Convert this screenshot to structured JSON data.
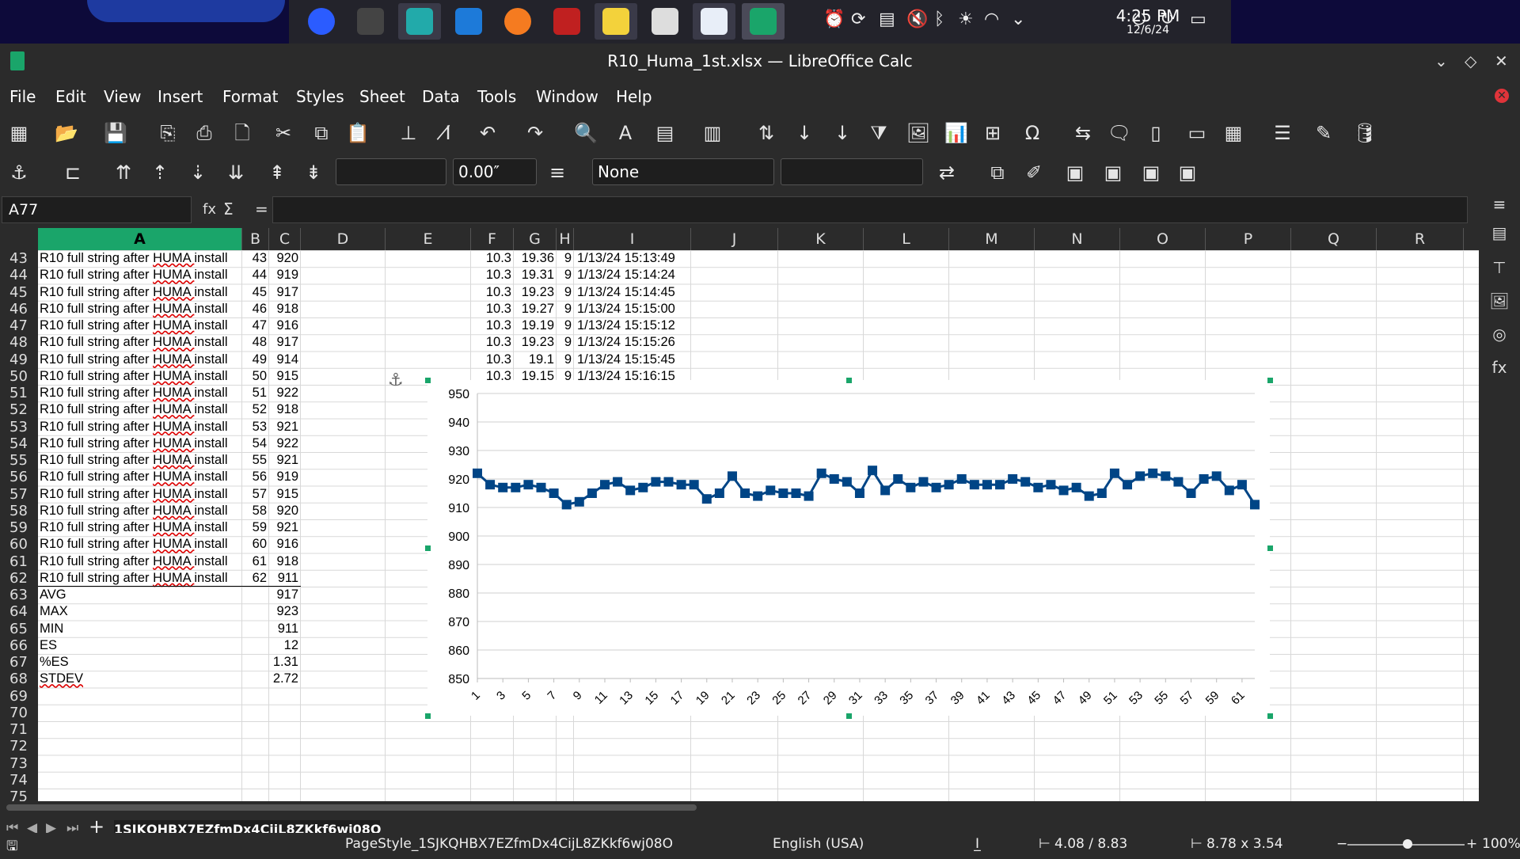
{
  "taskbar": {
    "time": "4:25 PM",
    "date": "12/6/24"
  },
  "window": {
    "title": "R10_Huma_1st.xlsx — LibreOffice Calc"
  },
  "menu": [
    "File",
    "Edit",
    "View",
    "Insert",
    "Format",
    "Styles",
    "Sheet",
    "Data",
    "Tools",
    "Window",
    "Help"
  ],
  "toolbar2": {
    "line_width": "0.00″",
    "arrow_style": "None"
  },
  "formula": {
    "name_box": "A77",
    "fx": "fx",
    "sigma": "Σ",
    "equals": "="
  },
  "columns": [
    "A",
    "B",
    "C",
    "D",
    "E",
    "F",
    "G",
    "H",
    "I",
    "J",
    "K",
    "L",
    "M",
    "N",
    "O",
    "P",
    "Q",
    "R"
  ],
  "rows_start": 43,
  "rows_count": 33,
  "data_rows": [
    {
      "a": "R10 full string after HUMA install",
      "b": "43",
      "c": "920",
      "f": "10.3",
      "g": "19.36",
      "h": "9",
      "i": "1/13/24 15:13:49"
    },
    {
      "a": "R10 full string after HUMA install",
      "b": "44",
      "c": "919",
      "f": "10.3",
      "g": "19.31",
      "h": "9",
      "i": "1/13/24 15:14:24"
    },
    {
      "a": "R10 full string after HUMA install",
      "b": "45",
      "c": "917",
      "f": "10.3",
      "g": "19.23",
      "h": "9",
      "i": "1/13/24 15:14:45"
    },
    {
      "a": "R10 full string after HUMA install",
      "b": "46",
      "c": "918",
      "f": "10.3",
      "g": "19.27",
      "h": "9",
      "i": "1/13/24 15:15:00"
    },
    {
      "a": "R10 full string after HUMA install",
      "b": "47",
      "c": "916",
      "f": "10.3",
      "g": "19.19",
      "h": "9",
      "i": "1/13/24 15:15:12"
    },
    {
      "a": "R10 full string after HUMA install",
      "b": "48",
      "c": "917",
      "f": "10.3",
      "g": "19.23",
      "h": "9",
      "i": "1/13/24 15:15:26"
    },
    {
      "a": "R10 full string after HUMA install",
      "b": "49",
      "c": "914",
      "f": "10.3",
      "g": "19.1",
      "h": "9",
      "i": "1/13/24 15:15:45"
    },
    {
      "a": "R10 full string after HUMA install",
      "b": "50",
      "c": "915",
      "f": "10.3",
      "g": "19.15",
      "h": "9",
      "i": "1/13/24 15:16:15"
    },
    {
      "a": "R10 full string after HUMA install",
      "b": "51",
      "c": "922"
    },
    {
      "a": "R10 full string after HUMA install",
      "b": "52",
      "c": "918"
    },
    {
      "a": "R10 full string after HUMA install",
      "b": "53",
      "c": "921"
    },
    {
      "a": "R10 full string after HUMA install",
      "b": "54",
      "c": "922"
    },
    {
      "a": "R10 full string after HUMA install",
      "b": "55",
      "c": "921"
    },
    {
      "a": "R10 full string after HUMA install",
      "b": "56",
      "c": "919"
    },
    {
      "a": "R10 full string after HUMA install",
      "b": "57",
      "c": "915"
    },
    {
      "a": "R10 full string after HUMA install",
      "b": "58",
      "c": "920"
    },
    {
      "a": "R10 full string after HUMA install",
      "b": "59",
      "c": "921"
    },
    {
      "a": "R10 full string after HUMA install",
      "b": "60",
      "c": "916"
    },
    {
      "a": "R10 full string after HUMA install",
      "b": "61",
      "c": "918"
    },
    {
      "a": "R10 full string after HUMA install",
      "b": "62",
      "c": "911"
    },
    {
      "a": "AVG",
      "c": "917"
    },
    {
      "a": "MAX",
      "c": "923"
    },
    {
      "a": "MIN",
      "c": "911"
    },
    {
      "a": "ES",
      "c": "12"
    },
    {
      "a": "%ES",
      "c": "1.31"
    },
    {
      "a": "STDEV",
      "c": "2.72"
    }
  ],
  "chart_data": {
    "type": "line",
    "x": [
      1,
      2,
      3,
      4,
      5,
      6,
      7,
      8,
      9,
      10,
      11,
      12,
      13,
      14,
      15,
      16,
      17,
      18,
      19,
      20,
      21,
      22,
      23,
      24,
      25,
      26,
      27,
      28,
      29,
      30,
      31,
      32,
      33,
      34,
      35,
      36,
      37,
      38,
      39,
      40,
      41,
      42,
      43,
      44,
      45,
      46,
      47,
      48,
      49,
      50,
      51,
      52,
      53,
      54,
      55,
      56,
      57,
      58,
      59,
      60,
      61,
      62
    ],
    "x_tick_labels": [
      "1",
      "3",
      "5",
      "7",
      "9",
      "11",
      "13",
      "15",
      "17",
      "19",
      "21",
      "23",
      "25",
      "27",
      "29",
      "31",
      "33",
      "35",
      "37",
      "39",
      "41",
      "43",
      "45",
      "47",
      "49",
      "51",
      "53",
      "55",
      "57",
      "59",
      "61"
    ],
    "series": [
      {
        "values": [
          922,
          918,
          917,
          917,
          918,
          917,
          915,
          911,
          912,
          915,
          918,
          919,
          916,
          917,
          919,
          919,
          918,
          918,
          913,
          915,
          921,
          915,
          914,
          916,
          915,
          915,
          914,
          922,
          920,
          919,
          915,
          923,
          916,
          920,
          917,
          919,
          917,
          918,
          920,
          918,
          918,
          918,
          920,
          919,
          917,
          918,
          916,
          917,
          914,
          915,
          922,
          918,
          921,
          922,
          921,
          919,
          915,
          920,
          921,
          916,
          918,
          911
        ],
        "color": "#004586"
      }
    ],
    "ylim": [
      850,
      950
    ],
    "y_ticks": [
      "850",
      "860",
      "870",
      "880",
      "890",
      "900",
      "910",
      "920",
      "930",
      "940",
      "950"
    ],
    "grid": true,
    "legend": "none"
  },
  "sheet_tab": "1SJKQHBX7EZfmDx4CijL8ZKkf6wj08O",
  "status": {
    "page_style": "PageStyle_1SJKQHBX7EZfmDx4CijL8ZKkf6wj08O",
    "language": "English (USA)",
    "position": "4.08 / 8.83",
    "size": "8.78 x 3.54",
    "zoom": "100%"
  }
}
